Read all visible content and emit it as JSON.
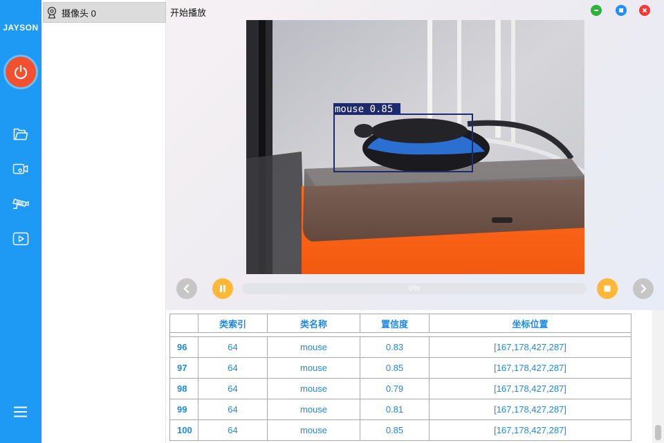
{
  "sidebar": {
    "brand": "JAYSON",
    "icons": [
      "power-icon",
      "folder-icon",
      "video-camera-icon",
      "cctv-camera-icon",
      "play-video-icon",
      "hamburger-menu-icon"
    ],
    "accent_color": "#1e9af5",
    "power_color": "#f2502e"
  },
  "camera_list": {
    "items": [
      {
        "label": "摄像头 0",
        "icon": "webcam-icon"
      }
    ]
  },
  "header": {
    "title": "开始播放",
    "window_controls": [
      {
        "name": "minimize",
        "color": "#2bb33a"
      },
      {
        "name": "maximize",
        "color": "#1e8fff"
      },
      {
        "name": "close",
        "color": "#f03a3a"
      }
    ]
  },
  "video": {
    "detection": {
      "label": "mouse 0.85",
      "box_color": "#1d2a6e"
    }
  },
  "playback": {
    "progress_text": "0%",
    "progress_value": 0,
    "control_color": "#ffb838",
    "nav_color": "#c6c6c6"
  },
  "table": {
    "headers": [
      "",
      "类索引",
      "类名称",
      "置信度",
      "坐标位置"
    ],
    "rows": [
      [
        "96",
        "64",
        "mouse",
        "0.83",
        "[167,178,427,287]"
      ],
      [
        "97",
        "64",
        "mouse",
        "0.85",
        "[167,178,427,287]"
      ],
      [
        "98",
        "64",
        "mouse",
        "0.79",
        "[167,178,427,287]"
      ],
      [
        "99",
        "64",
        "mouse",
        "0.81",
        "[167,178,427,287]"
      ],
      [
        "100",
        "64",
        "mouse",
        "0.85",
        "[167,178,427,287]"
      ]
    ],
    "text_color": "#1e88e5"
  }
}
